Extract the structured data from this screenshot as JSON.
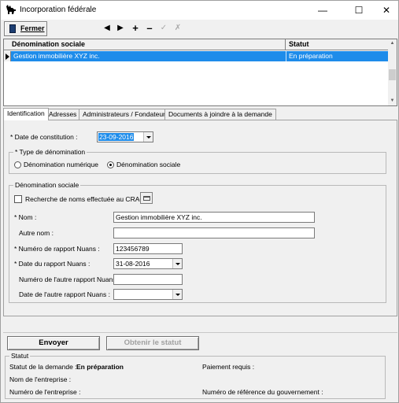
{
  "window": {
    "title": "Incorporation fédérale"
  },
  "toolbar": {
    "close_label": "Fermer"
  },
  "grid": {
    "headers": [
      "Dénomination sociale",
      "Statut"
    ],
    "rows": [
      {
        "name": "Gestion immobilière XYZ inc.",
        "status": "En préparation"
      }
    ]
  },
  "tabs": [
    "Identification",
    "Adresses",
    "Administrateurs / Fondateurs",
    "Documents à joindre à la demande"
  ],
  "identification": {
    "date_constitution_label": "* Date de constitution :",
    "date_constitution_value": "23-09-2016",
    "type_group_label": "* Type de dénomination",
    "radio_numerique": "Dénomination numérique",
    "radio_sociale": "Dénomination sociale",
    "selected_type": "sociale",
    "denom_group_label": "Dénomination sociale",
    "crac_label": "Recherche de noms effectuée au CRAC",
    "crac_checked": false,
    "nom_label": "* Nom :",
    "nom_value": "Gestion immobilière XYZ inc.",
    "autre_nom_label": "Autre nom :",
    "autre_nom_value": "",
    "nuans_num_label": "* Numéro de rapport Nuans :",
    "nuans_num_value": "123456789",
    "nuans_date_label": "* Date du rapport Nuans :",
    "nuans_date_value": "31-08-2016",
    "autre_nuans_num_label": "Numéro de l'autre rapport Nuans :",
    "autre_nuans_num_value": "",
    "autre_nuans_date_label": "Date de l'autre rapport Nuans :",
    "autre_nuans_date_value": ""
  },
  "actions": {
    "send_label": "Envoyer",
    "status_label": "Obtenir le statut"
  },
  "status": {
    "group_label": "Statut",
    "request_status_label": "Statut de la demande :",
    "request_status_value": "En préparation",
    "payment_label": "Paiement requis :",
    "company_name_label": "Nom de l'entreprise :",
    "company_number_label": "Numéro de l'entreprise :",
    "gov_ref_label": "Numéro de référence du gouvernement :"
  },
  "icons": {
    "app": "moose-icon",
    "prev": "triangle-left-icon",
    "next": "triangle-right-icon",
    "add": "plus-icon",
    "remove": "minus-icon",
    "save": "check-icon",
    "cancel": "x-icon"
  }
}
